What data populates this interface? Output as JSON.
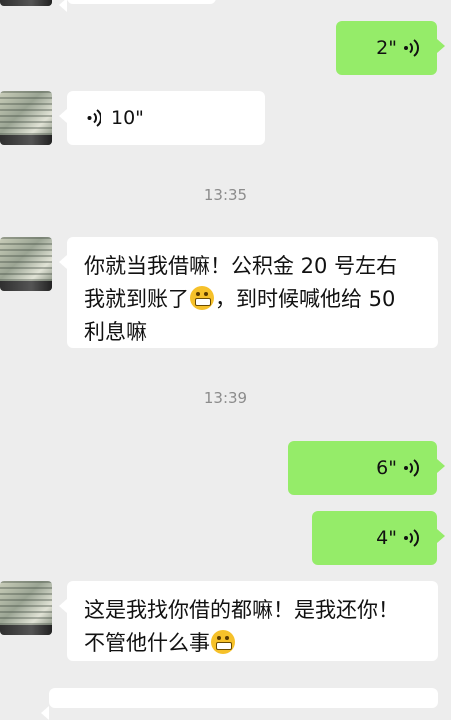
{
  "messages": {
    "voice_sent_1": {
      "duration": "2\""
    },
    "voice_recv_1": {
      "duration": "10\""
    },
    "time_1": "13:35",
    "text_recv_1": {
      "line1": "你就当我借嘛！公积金 20 号左右",
      "line2_before": "我就到账了",
      "line2_after": "，到时候喊他给 50",
      "line3": "利息嘛"
    },
    "time_2": "13:39",
    "voice_sent_2": {
      "duration": "6\""
    },
    "voice_sent_3": {
      "duration": "4\""
    },
    "text_recv_2": {
      "line1": "这是我找你借的都嘛！是我还你！",
      "line2_before": "不管他什么事"
    }
  },
  "icons": {
    "voice": "voice-wave-icon",
    "emoji": "grin-emoji-icon"
  },
  "colors": {
    "background": "#ededed",
    "sent_bubble": "#95ec69",
    "received_bubble": "#ffffff",
    "timestamp": "#8c8c8c"
  }
}
